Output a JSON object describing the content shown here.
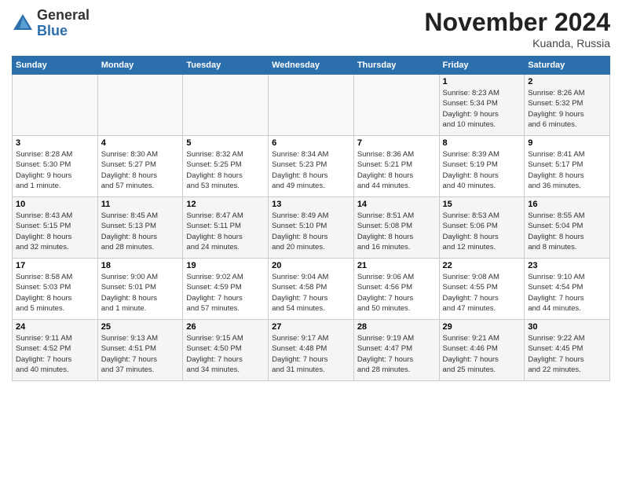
{
  "header": {
    "logo_line1": "General",
    "logo_line2": "Blue",
    "month": "November 2024",
    "location": "Kuanda, Russia"
  },
  "weekdays": [
    "Sunday",
    "Monday",
    "Tuesday",
    "Wednesday",
    "Thursday",
    "Friday",
    "Saturday"
  ],
  "weeks": [
    [
      {
        "day": "",
        "info": ""
      },
      {
        "day": "",
        "info": ""
      },
      {
        "day": "",
        "info": ""
      },
      {
        "day": "",
        "info": ""
      },
      {
        "day": "",
        "info": ""
      },
      {
        "day": "1",
        "info": "Sunrise: 8:23 AM\nSunset: 5:34 PM\nDaylight: 9 hours\nand 10 minutes."
      },
      {
        "day": "2",
        "info": "Sunrise: 8:26 AM\nSunset: 5:32 PM\nDaylight: 9 hours\nand 6 minutes."
      }
    ],
    [
      {
        "day": "3",
        "info": "Sunrise: 8:28 AM\nSunset: 5:30 PM\nDaylight: 9 hours\nand 1 minute."
      },
      {
        "day": "4",
        "info": "Sunrise: 8:30 AM\nSunset: 5:27 PM\nDaylight: 8 hours\nand 57 minutes."
      },
      {
        "day": "5",
        "info": "Sunrise: 8:32 AM\nSunset: 5:25 PM\nDaylight: 8 hours\nand 53 minutes."
      },
      {
        "day": "6",
        "info": "Sunrise: 8:34 AM\nSunset: 5:23 PM\nDaylight: 8 hours\nand 49 minutes."
      },
      {
        "day": "7",
        "info": "Sunrise: 8:36 AM\nSunset: 5:21 PM\nDaylight: 8 hours\nand 44 minutes."
      },
      {
        "day": "8",
        "info": "Sunrise: 8:39 AM\nSunset: 5:19 PM\nDaylight: 8 hours\nand 40 minutes."
      },
      {
        "day": "9",
        "info": "Sunrise: 8:41 AM\nSunset: 5:17 PM\nDaylight: 8 hours\nand 36 minutes."
      }
    ],
    [
      {
        "day": "10",
        "info": "Sunrise: 8:43 AM\nSunset: 5:15 PM\nDaylight: 8 hours\nand 32 minutes."
      },
      {
        "day": "11",
        "info": "Sunrise: 8:45 AM\nSunset: 5:13 PM\nDaylight: 8 hours\nand 28 minutes."
      },
      {
        "day": "12",
        "info": "Sunrise: 8:47 AM\nSunset: 5:11 PM\nDaylight: 8 hours\nand 24 minutes."
      },
      {
        "day": "13",
        "info": "Sunrise: 8:49 AM\nSunset: 5:10 PM\nDaylight: 8 hours\nand 20 minutes."
      },
      {
        "day": "14",
        "info": "Sunrise: 8:51 AM\nSunset: 5:08 PM\nDaylight: 8 hours\nand 16 minutes."
      },
      {
        "day": "15",
        "info": "Sunrise: 8:53 AM\nSunset: 5:06 PM\nDaylight: 8 hours\nand 12 minutes."
      },
      {
        "day": "16",
        "info": "Sunrise: 8:55 AM\nSunset: 5:04 PM\nDaylight: 8 hours\nand 8 minutes."
      }
    ],
    [
      {
        "day": "17",
        "info": "Sunrise: 8:58 AM\nSunset: 5:03 PM\nDaylight: 8 hours\nand 5 minutes."
      },
      {
        "day": "18",
        "info": "Sunrise: 9:00 AM\nSunset: 5:01 PM\nDaylight: 8 hours\nand 1 minute."
      },
      {
        "day": "19",
        "info": "Sunrise: 9:02 AM\nSunset: 4:59 PM\nDaylight: 7 hours\nand 57 minutes."
      },
      {
        "day": "20",
        "info": "Sunrise: 9:04 AM\nSunset: 4:58 PM\nDaylight: 7 hours\nand 54 minutes."
      },
      {
        "day": "21",
        "info": "Sunrise: 9:06 AM\nSunset: 4:56 PM\nDaylight: 7 hours\nand 50 minutes."
      },
      {
        "day": "22",
        "info": "Sunrise: 9:08 AM\nSunset: 4:55 PM\nDaylight: 7 hours\nand 47 minutes."
      },
      {
        "day": "23",
        "info": "Sunrise: 9:10 AM\nSunset: 4:54 PM\nDaylight: 7 hours\nand 44 minutes."
      }
    ],
    [
      {
        "day": "24",
        "info": "Sunrise: 9:11 AM\nSunset: 4:52 PM\nDaylight: 7 hours\nand 40 minutes."
      },
      {
        "day": "25",
        "info": "Sunrise: 9:13 AM\nSunset: 4:51 PM\nDaylight: 7 hours\nand 37 minutes."
      },
      {
        "day": "26",
        "info": "Sunrise: 9:15 AM\nSunset: 4:50 PM\nDaylight: 7 hours\nand 34 minutes."
      },
      {
        "day": "27",
        "info": "Sunrise: 9:17 AM\nSunset: 4:48 PM\nDaylight: 7 hours\nand 31 minutes."
      },
      {
        "day": "28",
        "info": "Sunrise: 9:19 AM\nSunset: 4:47 PM\nDaylight: 7 hours\nand 28 minutes."
      },
      {
        "day": "29",
        "info": "Sunrise: 9:21 AM\nSunset: 4:46 PM\nDaylight: 7 hours\nand 25 minutes."
      },
      {
        "day": "30",
        "info": "Sunrise: 9:22 AM\nSunset: 4:45 PM\nDaylight: 7 hours\nand 22 minutes."
      }
    ]
  ]
}
